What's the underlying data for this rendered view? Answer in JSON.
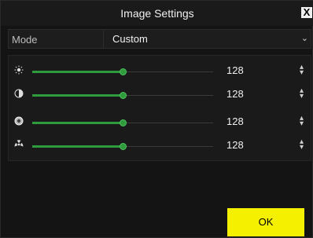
{
  "dialog": {
    "title": "Image Settings",
    "close_label": "X"
  },
  "mode": {
    "label": "Mode",
    "value": "Custom"
  },
  "adjustments": [
    {
      "icon": "brightness-icon",
      "value": "128",
      "level": 0.5
    },
    {
      "icon": "contrast-icon",
      "value": "128",
      "level": 0.5
    },
    {
      "icon": "saturation-icon",
      "value": "128",
      "level": 0.5
    },
    {
      "icon": "hue-icon",
      "value": "128",
      "level": 0.5
    }
  ],
  "footer": {
    "ok_label": "OK"
  },
  "colors": {
    "accent": "#2e9c3d",
    "ok_button": "#f5f000",
    "background": "#141414"
  }
}
